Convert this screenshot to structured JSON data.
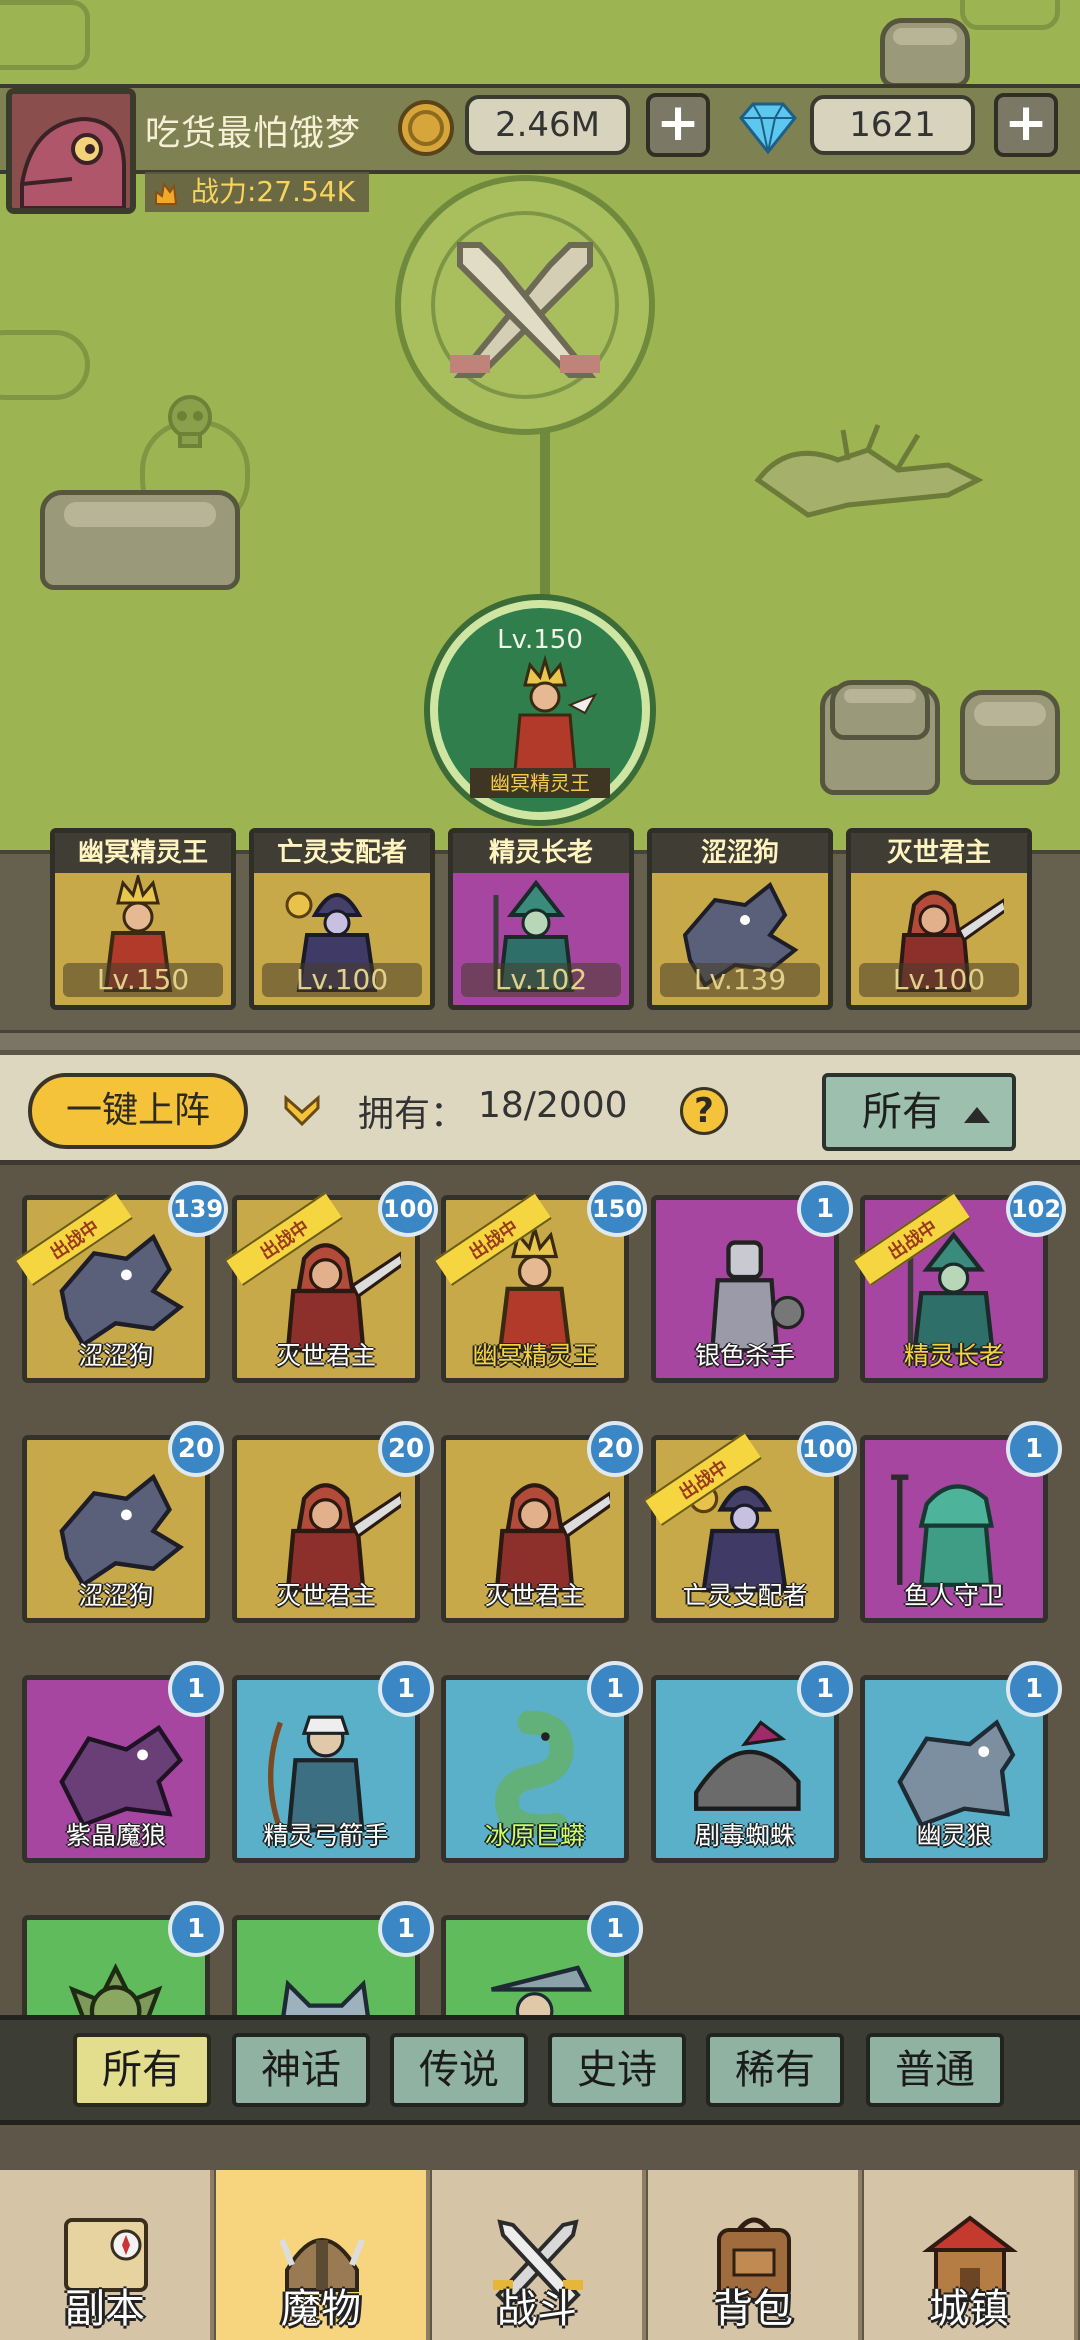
{
  "player": {
    "name": "吃货最怕饿梦",
    "power": "战力:27.54K",
    "gold": "2.46M",
    "diamonds": "1621",
    "plus_label": "+"
  },
  "featured": {
    "level": "Lv.150",
    "name": "幽冥精灵王"
  },
  "deployed": [
    {
      "name": "幽冥精灵王",
      "level": "Lv.150",
      "color": "#c8a94a"
    },
    {
      "name": "亡灵支配者",
      "level": "Lv.100",
      "color": "#c8a94a"
    },
    {
      "name": "精灵长老",
      "level": "Lv.102",
      "color": "#a646a0"
    },
    {
      "name": "涩涩狗",
      "level": "Lv.139",
      "color": "#c8a94a"
    },
    {
      "name": "灭世君主",
      "level": "Lv.100",
      "color": "#c8a94a"
    }
  ],
  "toolbar": {
    "deploy_all": "一键上阵",
    "owned_label": "拥有：",
    "owned_value": "18/2000",
    "help": "?",
    "filter_selected": "所有"
  },
  "ribbon_text": "出战中",
  "monsters": [
    {
      "name": "涩涩狗",
      "count": "139",
      "color": "#c8a94a",
      "deployed": true,
      "name_color": "white",
      "icon": "wolf-monster-icon"
    },
    {
      "name": "灭世君主",
      "count": "100",
      "color": "#c8a94a",
      "deployed": true,
      "name_color": "white",
      "icon": "warrior-monster-icon"
    },
    {
      "name": "幽冥精灵王",
      "count": "150",
      "color": "#c8a94a",
      "deployed": true,
      "name_color": "gold",
      "icon": "elf-king-monster-icon"
    },
    {
      "name": "银色杀手",
      "count": "1",
      "color": "#a646a0",
      "deployed": false,
      "name_color": "white",
      "icon": "knight-monster-icon"
    },
    {
      "name": "精灵长老",
      "count": "102",
      "color": "#a646a0",
      "deployed": true,
      "name_color": "gold",
      "icon": "elder-monster-icon"
    },
    {
      "name": "涩涩狗",
      "count": "20",
      "color": "#c8a94a",
      "deployed": false,
      "name_color": "white",
      "icon": "wolf-monster-icon"
    },
    {
      "name": "灭世君主",
      "count": "20",
      "color": "#c8a94a",
      "deployed": false,
      "name_color": "white",
      "icon": "warrior-monster-icon"
    },
    {
      "name": "灭世君主",
      "count": "20",
      "color": "#c8a94a",
      "deployed": false,
      "name_color": "white",
      "icon": "warrior-monster-icon"
    },
    {
      "name": "亡灵支配者",
      "count": "100",
      "color": "#c8a94a",
      "deployed": true,
      "name_color": "white",
      "icon": "lich-monster-icon"
    },
    {
      "name": "鱼人守卫",
      "count": "1",
      "color": "#a646a0",
      "deployed": false,
      "name_color": "white",
      "icon": "fishman-monster-icon"
    },
    {
      "name": "紫晶魔狼",
      "count": "1",
      "color": "#a646a0",
      "deployed": false,
      "name_color": "white",
      "icon": "purple-wolf-monster-icon"
    },
    {
      "name": "精灵弓箭手",
      "count": "1",
      "color": "#5ab0c8",
      "deployed": false,
      "name_color": "white",
      "icon": "archer-monster-icon"
    },
    {
      "name": "冰原巨蟒",
      "count": "1",
      "color": "#5ab0c8",
      "deployed": false,
      "name_color": "cyan",
      "icon": "serpent-monster-icon"
    },
    {
      "name": "剧毒蜘蛛",
      "count": "1",
      "color": "#5ab0c8",
      "deployed": false,
      "name_color": "white",
      "icon": "spider-monster-icon"
    },
    {
      "name": "幽灵狼",
      "count": "1",
      "color": "#5ab0c8",
      "deployed": false,
      "name_color": "white",
      "icon": "ghost-wolf-monster-icon"
    },
    {
      "name": "",
      "count": "1",
      "color": "#5fbb5c",
      "deployed": false,
      "name_color": "white",
      "icon": "goblin-monster-icon"
    },
    {
      "name": "",
      "count": "1",
      "color": "#5fbb5c",
      "deployed": false,
      "name_color": "white",
      "icon": "cat-monster-icon"
    },
    {
      "name": "",
      "count": "1",
      "color": "#5fbb5c",
      "deployed": false,
      "name_color": "white",
      "icon": "hat-monster-icon"
    }
  ],
  "filter_tabs": [
    "所有",
    "神话",
    "传说",
    "史诗",
    "稀有",
    "普通"
  ],
  "nav": [
    {
      "label": "副本",
      "icon": "map-icon"
    },
    {
      "label": "魔物",
      "icon": "helmet-icon"
    },
    {
      "label": "战斗",
      "icon": "crossed-swords-icon"
    },
    {
      "label": "背包",
      "icon": "backpack-icon"
    },
    {
      "label": "城镇",
      "icon": "house-icon"
    }
  ]
}
